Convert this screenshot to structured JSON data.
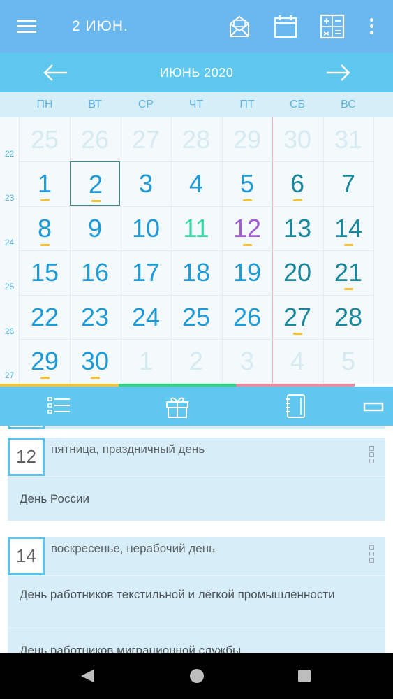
{
  "appbar": {
    "title": "2  ИЮН.",
    "actions": [
      "mail-icon",
      "calendar-icon",
      "calculator-icon",
      "overflow-menu-icon"
    ]
  },
  "month_bar": {
    "title": "ИЮНЬ 2020"
  },
  "weekdays": [
    "ПН",
    "ВТ",
    "СР",
    "ЧТ",
    "ПТ",
    "СБ",
    "ВС"
  ],
  "week_numbers": [
    "22",
    "23",
    "24",
    "25",
    "26",
    "27"
  ],
  "weeks": [
    [
      "25",
      "26",
      "27",
      "28",
      "29",
      "30",
      "31"
    ],
    [
      "1",
      "2",
      "3",
      "4",
      "5",
      "6",
      "7"
    ],
    [
      "8",
      "9",
      "10",
      "11",
      "12",
      "13",
      "14"
    ],
    [
      "15",
      "16",
      "17",
      "18",
      "19",
      "20",
      "21"
    ],
    [
      "22",
      "23",
      "24",
      "25",
      "26",
      "27",
      "28"
    ],
    [
      "29",
      "30",
      "1",
      "2",
      "3",
      "4",
      "5"
    ]
  ],
  "selected_day": "2",
  "colors": {
    "appbar": "#6ab8ee",
    "month_bar": "#5ec8ee",
    "weekday_text": "#1e9ad6",
    "weekend_text": "#19879c",
    "other_month_text": "#d6eaf2",
    "holiday_green": "#3ad6a4",
    "holiday_purple": "#a05ad6",
    "event_mark": "#f6c232",
    "progress": [
      "#f6c232",
      "#33d47f",
      "#f08a9a"
    ]
  },
  "tabs": [
    "list-icon",
    "gift-icon",
    "notebook-icon",
    "collapse-icon"
  ],
  "events": [
    {
      "day": "12",
      "caption": "пятница, праздничный день",
      "items": [
        "День России"
      ]
    },
    {
      "day": "14",
      "caption": "воскресенье, нерабочий день",
      "items": [
        "День работников текстильной и лёгкой промышленности",
        "День работников миграционной службы"
      ]
    }
  ],
  "navbar": [
    "back-icon",
    "home-icon",
    "recents-icon"
  ]
}
